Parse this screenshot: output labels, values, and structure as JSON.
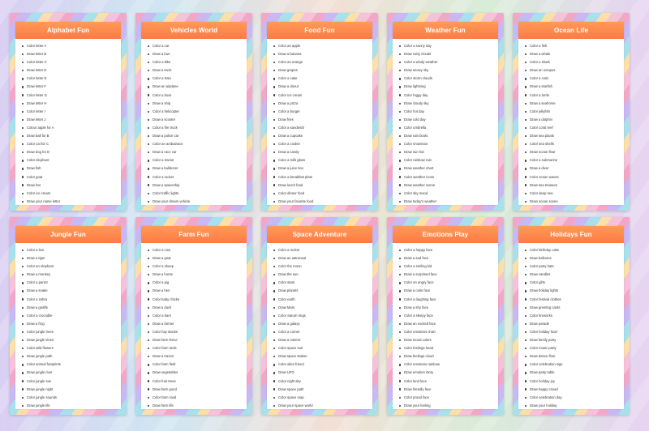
{
  "cards": [
    {
      "title": "Alphabet Fun",
      "items": [
        "Color letter A",
        "Draw letter B",
        "Color letter C",
        "Draw letter D",
        "Color letter E",
        "Draw letter F",
        "Color letter G",
        "Draw letter H",
        "Color letter I",
        "Draw letter J",
        "Colour apple for A",
        "Draw ball for B",
        "Color cat for C",
        "Draw dog for D",
        "Color elephant",
        "Draw fish",
        "Color goat",
        "Draw hat",
        "Color ice cream",
        "Draw your name letter"
      ]
    },
    {
      "title": "Vehicles World",
      "items": [
        "Color a car",
        "Draw a bus",
        "Color a bike",
        "Draw a truck",
        "Color a train",
        "Draw an airplane",
        "Color a boat",
        "Draw a ship",
        "Color a helicopter",
        "Draw a scooter",
        "Color a fire truck",
        "Draw a police car",
        "Color an ambulance",
        "Draw a race car",
        "Color a tractor",
        "Draw a bulldozer",
        "Color a rocket",
        "Draw a spaceship",
        "Color traffic lights",
        "Draw your dream vehicle"
      ]
    },
    {
      "title": "Food Fun",
      "items": [
        "Color an apple",
        "Draw a banana",
        "Color an orange",
        "Draw grapes",
        "Color a cake",
        "Draw a donut",
        "Color ice cream",
        "Draw a pizza",
        "Color a burger",
        "Draw fries",
        "Color a sandwich",
        "Draw a cupcake",
        "Color a cookie",
        "Draw a candy",
        "Color a milk glass",
        "Draw a juice box",
        "Color a breakfast plate",
        "Draw lunch food",
        "Color dinner food",
        "Draw your favorite food"
      ]
    },
    {
      "title": "Weather Fun",
      "items": [
        "Color a sunny day",
        "Draw rainy clouds",
        "Color a windy weather",
        "Draw snowy sky",
        "Color storm clouds",
        "Draw lightning",
        "Color foggy day",
        "Draw cloudy sky",
        "Color hot day",
        "Draw cold day",
        "Color umbrella",
        "Draw rain boots",
        "Color snowman",
        "Draw sun hat",
        "Color rainbow rain",
        "Draw weather chart",
        "Color weather icons",
        "Draw weather scene",
        "Color sky mood",
        "Draw today's weather"
      ]
    },
    {
      "title": "Ocean Life",
      "items": [
        "Color a fish",
        "Draw a whale",
        "Color a shark",
        "Draw an octopus",
        "Color a crab",
        "Draw a starfish",
        "Color a turtle",
        "Draw a seahorse",
        "Color jellyfish",
        "Draw a dolphin",
        "Color coral reef",
        "Draw sea plants",
        "Color sea shells",
        "Draw ocean floor",
        "Color a submarine",
        "Draw a diver",
        "Color ocean waves",
        "Draw sea treasure",
        "Color deep sea",
        "Draw ocean scene"
      ]
    },
    {
      "title": "Jungle Fun",
      "items": [
        "Color a lion",
        "Draw a tiger",
        "Color an elephant",
        "Draw a monkey",
        "Color a parrot",
        "Draw a snake",
        "Color a zebra",
        "Draw a giraffe",
        "Color a crocodile",
        "Draw a frog",
        "Color jungle trees",
        "Draw jungle vines",
        "Color wild flowers",
        "Draw jungle path",
        "Color animal footprints",
        "Draw jungle river",
        "Color jungle sun",
        "Draw jungle night",
        "Color jungle sounds",
        "Draw jungle life"
      ]
    },
    {
      "title": "Farm Fun",
      "items": [
        "Color a cow",
        "Draw a goat",
        "Color a sheep",
        "Draw a horse",
        "Color a pig",
        "Draw a hen",
        "Color baby chicks",
        "Draw a duck",
        "Color a barn",
        "Draw a farmer",
        "Color hay stacks",
        "Draw farm fence",
        "Color farm tools",
        "Draw a tractor",
        "Color farm field",
        "Draw vegetables",
        "Color fruit trees",
        "Draw farm pond",
        "Color farm road",
        "Draw farm life"
      ]
    },
    {
      "title": "Space Adventure",
      "items": [
        "Color a rocket",
        "Draw an astronaut",
        "Color the moon",
        "Draw the sun",
        "Color stars",
        "Draw planets",
        "Color earth",
        "Draw Mars",
        "Color Saturn rings",
        "Draw a galaxy",
        "Color a comet",
        "Draw a meteor",
        "Color space suit",
        "Draw space station",
        "Color alien friend",
        "Draw UFO",
        "Color night sky",
        "Draw space path",
        "Color space map",
        "Draw your space world"
      ]
    },
    {
      "title": "Emotions Play",
      "items": [
        "Color a happy face",
        "Draw a sad face",
        "Color a smiling kid",
        "Draw a surprised face",
        "Color an angry face",
        "Draw a calm face",
        "Color a laughing face",
        "Draw a shy face",
        "Color a sleepy face",
        "Draw an excited face",
        "Color emotions chart",
        "Draw mood colors",
        "Color feelings heart",
        "Draw feelings cloud",
        "Color emotions rainbow",
        "Draw emotion story",
        "Color kind face",
        "Draw friendly face",
        "Color proud face",
        "Draw your feeling"
      ]
    },
    {
      "title": "Holidays Fun",
      "items": [
        "Color birthday cake",
        "Draw balloons",
        "Color party hats",
        "Draw candles",
        "Color gifts",
        "Draw holiday lights",
        "Color festival clothes",
        "Draw greeting cards",
        "Color fireworks",
        "Draw parade",
        "Color holiday food",
        "Draw family party",
        "Color music party",
        "Draw dance floor",
        "Color celebration sign",
        "Draw party table",
        "Color holiday joy",
        "Draw happy crowd",
        "Color celebration day",
        "Draw your holiday"
      ]
    }
  ]
}
